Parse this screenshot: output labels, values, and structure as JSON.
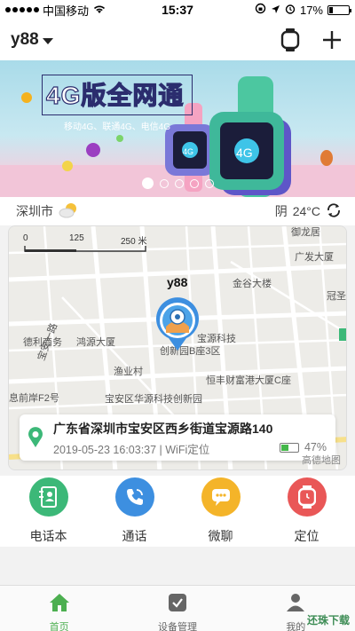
{
  "status_bar": {
    "carrier": "中国移动",
    "time": "15:37",
    "battery_percent": "17%",
    "battery_level": 0.17
  },
  "header": {
    "device_name": "y88",
    "icons": [
      "watch-icon",
      "plus-icon"
    ]
  },
  "banner": {
    "title": "4G版全网通",
    "subtitle": "移动4G、联通4G、电信4G",
    "watch_screen_text": "4G",
    "slide_count": 5,
    "active_slide": 1
  },
  "weather": {
    "city": "深圳市",
    "condition": "阴",
    "temperature": "24°C"
  },
  "map": {
    "scale_labels": [
      "0",
      "125",
      "250 米"
    ],
    "device_label": "y88",
    "place_labels": {
      "yulongju": "御龙居",
      "guangfa": "广发大厦",
      "jingu": "金谷大楼",
      "guanzi": "冠圣",
      "deli": "德利商务",
      "hongyuan": "鸿源大厦",
      "baoyuan": "宝源科技",
      "chuangxin": "创新园B座3区",
      "yuye": "渔业村",
      "hengfeng": "恒丰财富港大厦C座",
      "xiqian": "息前岸F2号",
      "huayuan": "宝安区华源科技创新园",
      "baoyi": "宝安一路"
    },
    "address": "广东省深圳市宝安区西乡街道宝源路140",
    "updated": "2019-05-23 16:03:37 | WiFi定位",
    "device_battery": "47%",
    "device_battery_level": 0.47,
    "provider": "高德地图"
  },
  "functions": [
    {
      "label": "电话本",
      "icon": "phonebook-icon",
      "color": "#3cb878"
    },
    {
      "label": "通话",
      "icon": "phone-call-icon",
      "color": "#3d8fe0"
    },
    {
      "label": "微聊",
      "icon": "chat-icon",
      "color": "#f4b429"
    },
    {
      "label": "定位",
      "icon": "watch-locate-icon",
      "color": "#e95757"
    }
  ],
  "tabs": [
    {
      "label": "首页",
      "icon": "home-icon",
      "active": true
    },
    {
      "label": "设备管理",
      "icon": "device-manage-icon",
      "active": false
    },
    {
      "label": "我的",
      "icon": "profile-icon",
      "active": false
    }
  ],
  "watermark": "还珠下载",
  "colors": {
    "accent_green": "#4caf50",
    "banner_title_stroke": "#2b2d6e"
  }
}
